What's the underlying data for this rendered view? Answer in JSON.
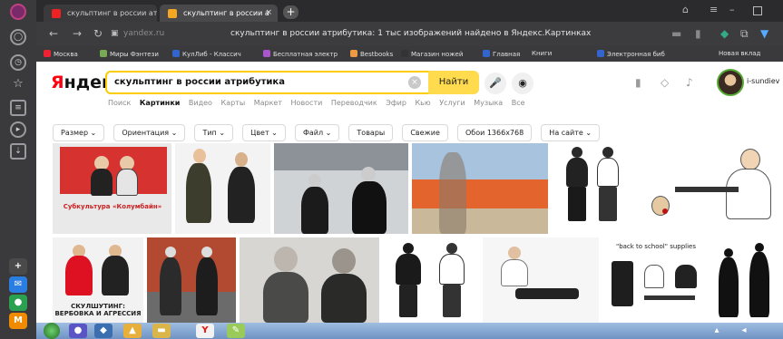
{
  "browser": {
    "tabs": [
      {
        "label": "скульптинг в россии атр",
        "active": false
      },
      {
        "label": "скульптинг в россии а",
        "active": true
      }
    ],
    "close_glyph": "×",
    "new_tab_glyph": "+",
    "url": "yandex.ru",
    "page_title": "скульптинг в россии атрибутика: 1 тыс изображений найдено в Яндекс.Картинках",
    "bookmarks": [
      "Москва",
      "Миры Фэнтези",
      "КулЛиб - Классич",
      "Бесплатная электр",
      "Bestbooks",
      "Магазин ножей",
      "Главная",
      "Книги",
      "Электронная биб",
      "Новая вклад"
    ],
    "bookmark_colors": [
      "#e23",
      "#7a5",
      "#36c",
      "#a5c",
      "#e94",
      "#333",
      "#36c",
      "#999",
      "#36c",
      "#999"
    ]
  },
  "yandex": {
    "logo_first": "Я",
    "logo_rest": "ндекс",
    "query": "скульптинг в россии атрибутика",
    "find_label": "Найти",
    "username": "i-sundiev",
    "services": [
      "Поиск",
      "Картинки",
      "Видео",
      "Карты",
      "Маркет",
      "Новости",
      "Переводчик",
      "Эфир",
      "Кью",
      "Услуги",
      "Музыка",
      "Все"
    ],
    "active_service": "Картинки",
    "filters": [
      "Размер ⌄",
      "Ориентация ⌄",
      "Тип ⌄",
      "Цвет ⌄",
      "Файл ⌄",
      "Товары",
      "Свежие",
      "Обои 1366x768",
      "На сайте ⌄"
    ]
  },
  "captions": {
    "img1": "Субкультура «Колумбайн»",
    "img7": "СКУЛШУТИНГ: ВЕРБОВКА И АГРЕССИЯ",
    "img12": "\"back to school\" supplies"
  },
  "icons": {
    "sidebar": [
      "browser-logo-icon",
      "alice-icon",
      "history-icon",
      "bookmarks-icon",
      "notes-icon",
      "play-icon",
      "downloads-icon"
    ],
    "nav": [
      "back-icon",
      "forward-icon",
      "reload-icon",
      "lock-icon"
    ]
  },
  "colors": {
    "accent": "#ffdb4d",
    "brand_red": "#ff0011"
  }
}
